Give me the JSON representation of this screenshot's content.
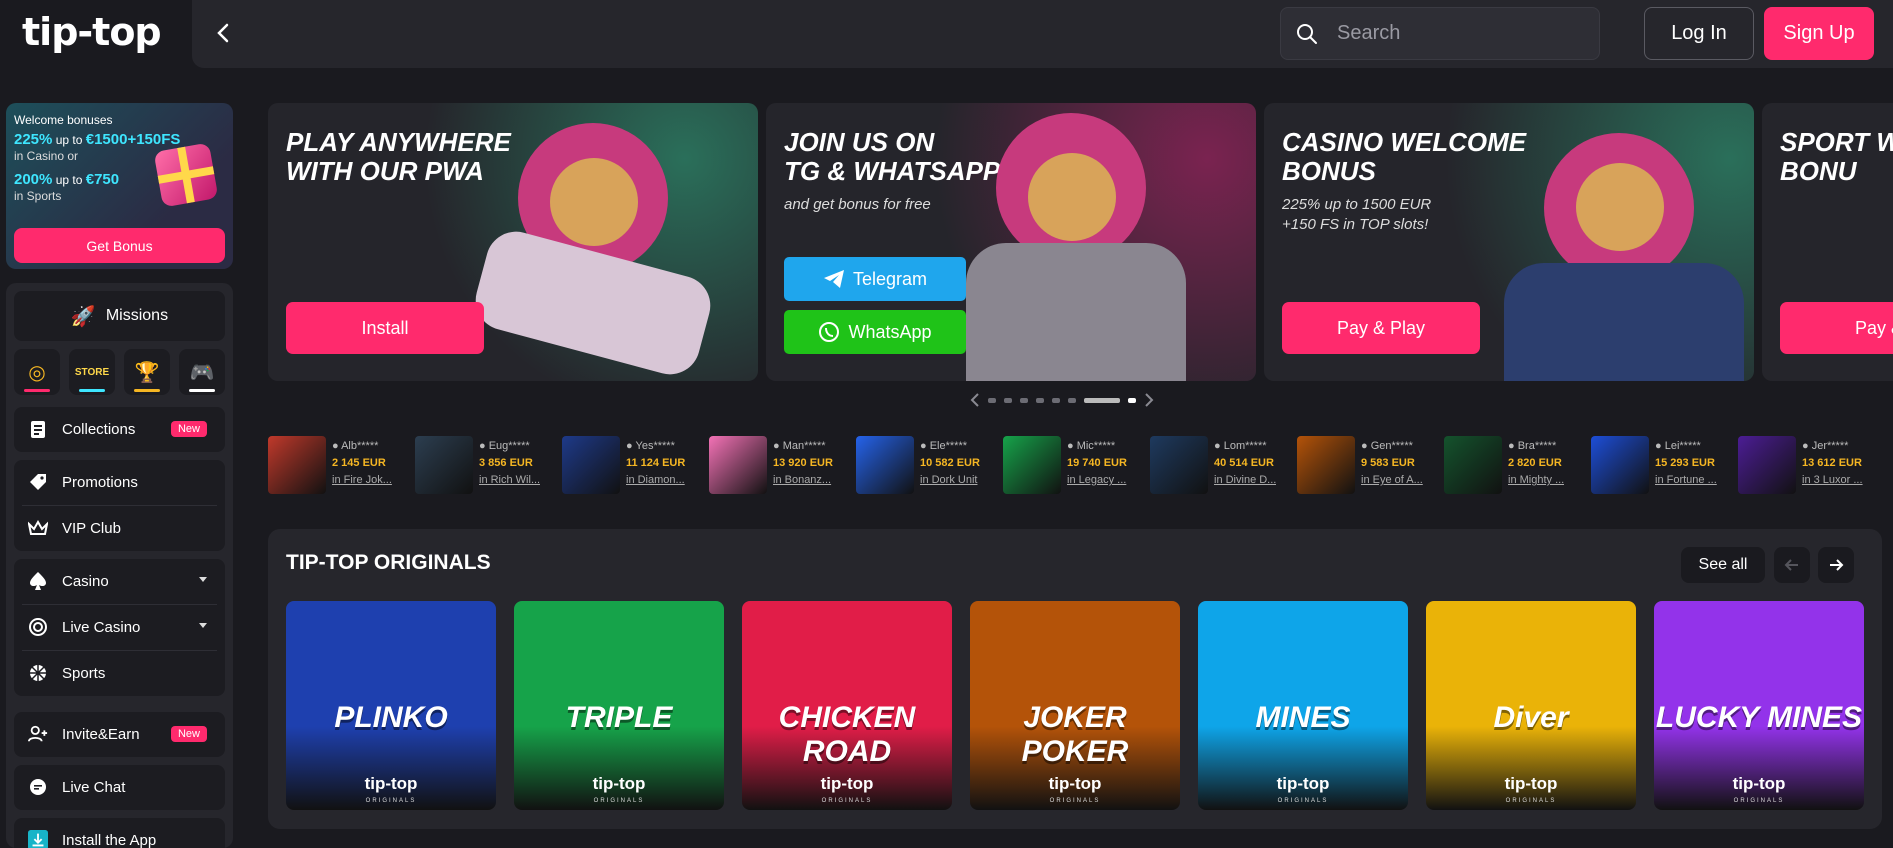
{
  "header": {
    "logo_text": "tip-top",
    "search_placeholder": "Search",
    "login_label": "Log In",
    "signup_label": "Sign Up"
  },
  "welcome": {
    "title": "Welcome bonuses",
    "line1_big": "225%",
    "line1_mid": " up to ",
    "line1_amount": "€1500+150FS",
    "line1_small": "in Casino or",
    "line2_big": "200%",
    "line2_mid": " up to ",
    "line2_amount": "€750",
    "line2_small": "in Sports",
    "button_label": "Get Bonus"
  },
  "sidebar": {
    "missions_label": "Missions",
    "mission_icons": [
      {
        "icon": "wheel-icon",
        "color": "#ff2a6d"
      },
      {
        "icon": "store-icon",
        "color": "#3ee6ff"
      },
      {
        "icon": "trophy-icon",
        "color": "#f5b623"
      },
      {
        "icon": "gamepad-icon",
        "color": "#ffffff"
      }
    ],
    "collections_label": "Collections",
    "collections_badge": "New",
    "promotions_label": "Promotions",
    "vip_label": "VIP Club",
    "casino_label": "Casino",
    "live_casino_label": "Live Casino",
    "sports_label": "Sports",
    "invite_label": "Invite&Earn",
    "invite_badge": "New",
    "live_chat_label": "Live Chat",
    "install_label": "Install the App"
  },
  "banners": [
    {
      "title_line1": "PLAY ANYWHERE",
      "title_line2": "WITH OUR PWA",
      "cta": "Install"
    },
    {
      "title_line1": "JOIN US ON",
      "title_line2": "TG & WHATSAPP",
      "sub": "and get bonus for free",
      "telegram": "Telegram",
      "whatsapp": "WhatsApp"
    },
    {
      "title_line1": "CASINO WELCOME",
      "title_line2": "BONUS",
      "sub_line1": "225% up to 1500 EUR",
      "sub_line2": "+150 FS in TOP slots!",
      "cta": "Pay & Play"
    },
    {
      "title_line1": "SPORT W",
      "title_line2": "BONU",
      "cta": "Pay &"
    }
  ],
  "winners": [
    {
      "user": "Alb*****",
      "amount": "2 145 EUR",
      "game": "in Fire Jok...",
      "color": "#c0392b"
    },
    {
      "user": "Eug*****",
      "amount": "3 856 EUR",
      "game": "in Rich Wil...",
      "color": "#2c3e50"
    },
    {
      "user": "Yes*****",
      "amount": "11 124 EUR",
      "game": "in Diamon...",
      "color": "#1e3a8a"
    },
    {
      "user": "Man*****",
      "amount": "13 920 EUR",
      "game": "in Bonanz...",
      "color": "#f472b6"
    },
    {
      "user": "Ele*****",
      "amount": "10 582 EUR",
      "game": "in Dork Unit",
      "color": "#2563eb"
    },
    {
      "user": "Mic*****",
      "amount": "19 740 EUR",
      "game": "in Legacy ...",
      "color": "#16a34a"
    },
    {
      "user": "Lom*****",
      "amount": "40 514 EUR",
      "game": "in Divine D...",
      "color": "#1e3a5f"
    },
    {
      "user": "Gen*****",
      "amount": "9 583 EUR",
      "game": "in Eye of A...",
      "color": "#b45309"
    },
    {
      "user": "Bra*****",
      "amount": "2 820 EUR",
      "game": "in Mighty ...",
      "color": "#14532d"
    },
    {
      "user": "Lei*****",
      "amount": "15 293 EUR",
      "game": "in Fortune ...",
      "color": "#1d4ed8"
    },
    {
      "user": "Jer*****",
      "amount": "13 612 EUR",
      "game": "in 3 Luxor ...",
      "color": "#4c1d95"
    }
  ],
  "originals": {
    "title": "TIP-TOP ORIGINALS",
    "see_all": "See all",
    "cards": [
      {
        "name": "PLINKO",
        "brand": "tip-top",
        "brand_sub": "ORIGINALS",
        "bg": "#1e40af"
      },
      {
        "name": "TRIPLE",
        "brand": "tip-top",
        "brand_sub": "ORIGINALS",
        "bg": "#16a34a"
      },
      {
        "name": "CHICKEN ROAD",
        "brand": "tip-top",
        "brand_sub": "ORIGINALS",
        "bg": "#e11d48"
      },
      {
        "name": "JOKER POKER",
        "brand": "tip-top",
        "brand_sub": "ORIGINALS",
        "bg": "#b45309"
      },
      {
        "name": "MINES",
        "brand": "tip-top",
        "brand_sub": "ORIGINALS",
        "bg": "#0ea5e9"
      },
      {
        "name": "Diver",
        "brand": "tip-top",
        "brand_sub": "ORIGINALS",
        "bg": "#eab308"
      },
      {
        "name": "LUCKY MINES",
        "brand": "tip-top",
        "brand_sub": "ORIGINALS",
        "bg": "#9333ea"
      }
    ]
  }
}
